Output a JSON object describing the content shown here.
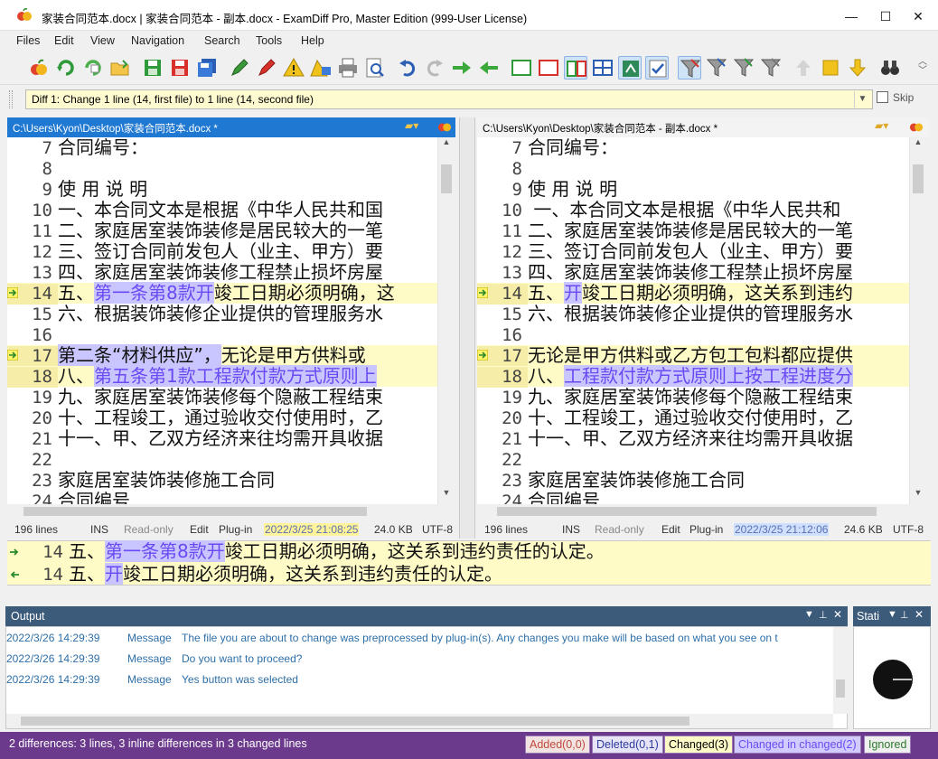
{
  "window": {
    "title": "家装合同范本.docx | 家装合同范本 - 副本.docx - ExamDiff Pro, Master Edition (999-User License)",
    "minimize": "—",
    "maximize": "☐",
    "close": "✕"
  },
  "menu": [
    "Files",
    "Edit",
    "View",
    "Navigation",
    "Search",
    "Tools",
    "Help"
  ],
  "toolbar_icons": [
    "open-file-icon",
    "refresh-icon",
    "recompare-icon",
    "open-folder-icon",
    "save-left-icon",
    "save-right-icon",
    "save-all-icon",
    "edit-left-icon",
    "edit-right-icon",
    "warning-icon",
    "filter-icon",
    "print-icon",
    "print-preview-icon",
    "undo-icon",
    "redo-icon",
    "next-diff-icon",
    "prev-diff-icon",
    "view-left-icon",
    "view-right-icon",
    "view-split-icon",
    "view-grid-icon",
    "sync-icon",
    "check-icon",
    "filter-1-icon",
    "filter-2-icon",
    "filter-3-icon",
    "filter-4-icon",
    "up-icon",
    "stop-icon",
    "down-icon",
    "binoculars-icon"
  ],
  "diff_bar": {
    "value": "Diff 1: Change 1 line (14, first file) to 1 line (14, second file)",
    "skip_label": "Skip"
  },
  "left": {
    "path": "C:\\Users\\Kyon\\Desktop\\家装合同范本.docx *",
    "status": {
      "lines": "196 lines",
      "ins": "INS",
      "readonly": "Read-only",
      "edit": "Edit",
      "plugin": "Plug-in",
      "date": "2022/3/25 21:08:25",
      "size": "24.0 KB",
      "enc": "UTF-8"
    }
  },
  "right": {
    "path": "C:\\Users\\Kyon\\Desktop\\家装合同范本 - 副本.docx *",
    "status": {
      "lines": "196 lines",
      "ins": "INS",
      "readonly": "Read-only",
      "edit": "Edit",
      "plugin": "Plug-in",
      "date": "2022/3/25 21:12:06",
      "size": "24.6 KB",
      "enc": "UTF-8"
    }
  },
  "left_lines": [
    {
      "n": "7",
      "t": "合同编号："
    },
    {
      "n": "8",
      "t": ""
    },
    {
      "n": "9",
      "t": "使 用 说 明"
    },
    {
      "n": "10",
      "t": "一、本合同文本是根据《中华人民共和国"
    },
    {
      "n": "11",
      "t": "二、家庭居室装饰装修是居民较大的一笔"
    },
    {
      "n": "12",
      "t": "三、签订合同前发包人（业主、甲方）要"
    },
    {
      "n": "13",
      "t": "四、家庭居室装饰装修工程禁止损坏房屋"
    },
    {
      "n": "14",
      "pre": "五、",
      "hl": "第一条第8款开",
      "post": "竣工日期必须明确，这"
    },
    {
      "n": "15",
      "t": "六、根据装饰装修企业提供的管理服务水"
    },
    {
      "n": "16",
      "t": ""
    },
    {
      "n": "17",
      "pre": "",
      "hl": "第二条“材料供应”，",
      "post": "无论是甲方供料或"
    },
    {
      "n": "18",
      "pre": "八、",
      "hl": "第五条第1款工程款付款方式原则上",
      "post": ""
    },
    {
      "n": "19",
      "t": "九、家庭居室装饰装修每个隐蔽工程结束"
    },
    {
      "n": "20",
      "t": "十、工程竣工，通过验收交付使用时，乙"
    },
    {
      "n": "21",
      "t": "十一、甲、乙双方经济来往均需开具收据"
    },
    {
      "n": "22",
      "t": ""
    },
    {
      "n": "23",
      "t": "家庭居室装饰装修施工合同"
    },
    {
      "n": "24",
      "t": "合同编号"
    }
  ],
  "right_lines": [
    {
      "n": "7",
      "t": "合同编号："
    },
    {
      "n": "8",
      "t": ""
    },
    {
      "n": "9",
      "t": "使  用  说  明"
    },
    {
      "n": "10",
      "t": "  一、本合同文本是根据《中华人民共和"
    },
    {
      "n": "11",
      "t": "二、家庭居室装饰装修是居民较大的一笔"
    },
    {
      "n": "12",
      "t": "三、签订合同前发包人（业主、甲方）要"
    },
    {
      "n": "13",
      "t": "四、家庭居室装饰装修工程禁止损坏房屋"
    },
    {
      "n": "14",
      "pre": "五、",
      "hl": "开",
      "post": "竣工日期必须明确，这关系到违约"
    },
    {
      "n": "15",
      "t": "六、根据装饰装修企业提供的管理服务水"
    },
    {
      "n": "16",
      "t": ""
    },
    {
      "n": "17",
      "pre": "",
      "hl": "",
      "post": "无论是甲方供料或乙方包工包料都应提供"
    },
    {
      "n": "18",
      "pre": "八、",
      "hl": "工程款付款方式原则上按工程进度分",
      "post": ""
    },
    {
      "n": "19",
      "t": "九、家庭居室装饰装修每个隐蔽工程结束"
    },
    {
      "n": "20",
      "t": "十、工程竣工，通过验收交付使用时，乙"
    },
    {
      "n": "21",
      "t": "十一、甲、乙双方经济来往均需开具收据"
    },
    {
      "n": "22",
      "t": ""
    },
    {
      "n": "23",
      "t": "家庭居室装饰装修施工合同"
    },
    {
      "n": "24",
      "t": "合同编号"
    }
  ],
  "compare": [
    {
      "n": "14",
      "pre": "五、",
      "hl": "第一条第8款开",
      "post": "竣工日期必须明确，这关系到违约责任的认定。"
    },
    {
      "n": "14",
      "pre": "五、",
      "hl": "开",
      "post": "竣工日期必须明确，这关系到违约责任的认定。"
    }
  ],
  "output": {
    "title": "Output",
    "rows": [
      {
        "ts": "2022/3/26 14:29:39",
        "type": "Message",
        "msg": "The file you are about to change was preprocessed by plug-in(s). Any changes you make will be based on what you see on t"
      },
      {
        "ts": "2022/3/26 14:29:39",
        "type": "Message",
        "msg": "Do you want to proceed?"
      },
      {
        "ts": "2022/3/26 14:29:39",
        "type": "Message",
        "msg": "Yes button was selected"
      }
    ]
  },
  "statistics": {
    "title": "Stati"
  },
  "statusbar": {
    "summary": "2 differences: 3 lines, 3 inline differences in 3 changed lines",
    "added": "Added(0,0)",
    "deleted": "Deleted(0,1)",
    "changed": "Changed(3)",
    "changed_in_changed": "Changed in changed(2)",
    "ignored": "Ignored"
  },
  "colors": {
    "accent": "#1f78d1",
    "changed": "#fffbc6",
    "inline": "#c9c6ff",
    "statusbar": "#6b3a8c"
  }
}
